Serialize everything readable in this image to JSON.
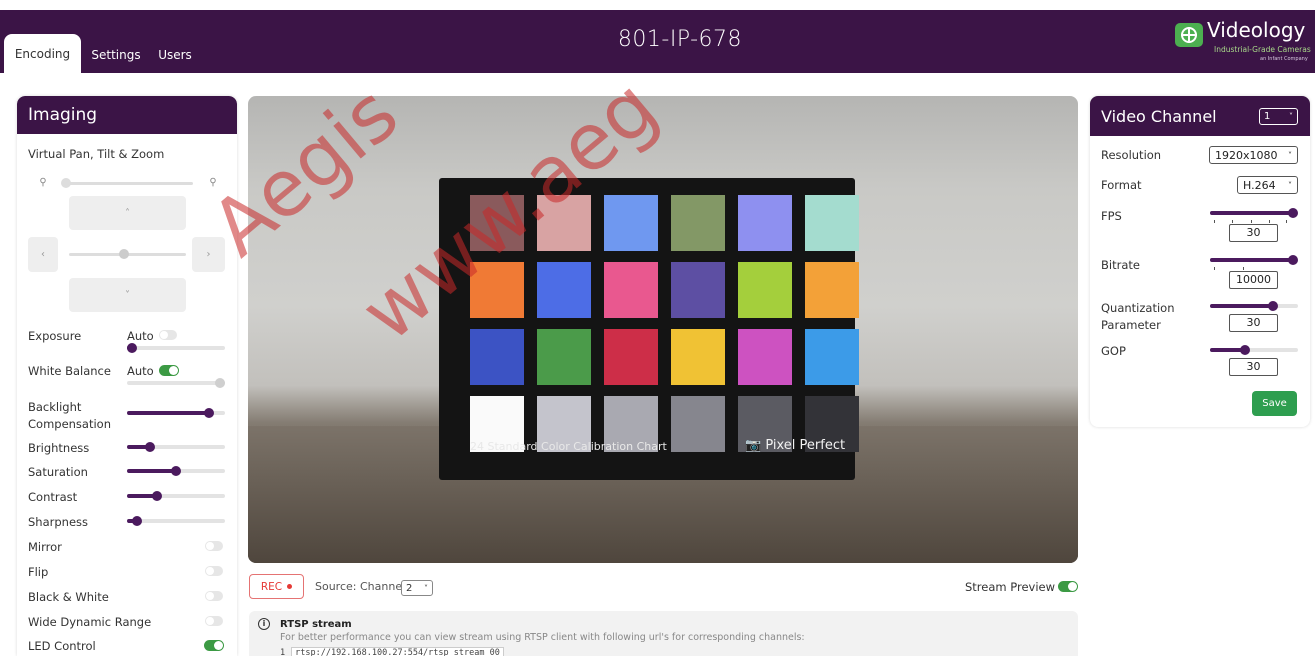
{
  "header": {
    "tabs": [
      {
        "label": "Encoding",
        "active": true
      },
      {
        "label": "Settings",
        "active": false
      },
      {
        "label": "Users",
        "active": false
      }
    ],
    "title": "801-IP-678",
    "logo": {
      "name": "Videology",
      "tagline": "Industrial-Grade Cameras",
      "sub": "an Infant Company",
      "icon": "globe-icon"
    }
  },
  "imaging": {
    "title": "Imaging",
    "ptz": {
      "title": "Virtual Pan, Tilt & Zoom",
      "zoom_level": 0,
      "pan_level": 0.5
    },
    "exposure": {
      "label": "Exposure",
      "auto_label": "Auto",
      "auto": false,
      "level": 0.0
    },
    "white_balance": {
      "label": "White Balance",
      "auto_label": "Auto",
      "auto": true,
      "level": 1.0
    },
    "backlight": {
      "label": "Backlight Compensation",
      "level": 0.87
    },
    "brightness": {
      "label": "Brightness",
      "level": 0.2
    },
    "saturation": {
      "label": "Saturation",
      "level": 0.5
    },
    "contrast": {
      "label": "Contrast",
      "level": 0.28
    },
    "sharpness": {
      "label": "Sharpness",
      "level": 0.06
    },
    "toggles": [
      {
        "label": "Mirror",
        "on": false
      },
      {
        "label": "Flip",
        "on": false
      },
      {
        "label": "Black & White",
        "on": false
      },
      {
        "label": "Wide Dynamic Range",
        "on": false
      },
      {
        "label": "LED Control",
        "on": true
      }
    ]
  },
  "video": {
    "card_caption": "24 Standard Color Calibration Chart",
    "card_brand": "Pixel Perfect",
    "swatches": [
      "#8a5a5c",
      "#d8a3a3",
      "#6f98f0",
      "#839866",
      "#8e90f0",
      "#a4dccf",
      "#f07a35",
      "#4d6de6",
      "#e9588f",
      "#5d4fa3",
      "#a4cf3c",
      "#f3a138",
      "#3c53c4",
      "#4b9b4a",
      "#cd2e48",
      "#f0c234",
      "#cd52c1",
      "#3c9be8",
      "#fafafa",
      "#c4c4cc",
      "#a9a9b1",
      "#86868e",
      "#5b5b62",
      "#333338"
    ]
  },
  "stream": {
    "rec_label": "REC",
    "source_label": "Source: Channel",
    "source_channel": "2",
    "preview_label": "Stream Preview",
    "preview_on": true,
    "rtsp_title": "RTSP stream",
    "rtsp_desc": "For better performance you can view stream using RTSP client with following url's for corresponding channels:",
    "rtsp_rows": [
      {
        "channel": "1",
        "url": "rtsp://192.168.100.27:554/rtsp_stream_00"
      }
    ]
  },
  "video_channel": {
    "title": "Video Channel",
    "channel": "1",
    "resolution": {
      "label": "Resolution",
      "value": "1920x1080"
    },
    "format": {
      "label": "Format",
      "value": "H.264"
    },
    "fps": {
      "label": "FPS",
      "value": "30",
      "level": 1.0
    },
    "bitrate": {
      "label": "Bitrate",
      "value": "10000",
      "level": 1.0
    },
    "qp": {
      "label": "Quantization Parameter",
      "value": "30",
      "level": 0.74
    },
    "gop": {
      "label": "GOP",
      "value": "30",
      "level": 0.38
    },
    "save_label": "Save"
  },
  "watermark": {
    "line1": "Aegis",
    "line2": "www.aeg"
  },
  "colors": {
    "brand": "#3b1446",
    "accent_green": "#3c9a44",
    "rec_red": "#e53935",
    "slider": "#4b1a5e"
  }
}
